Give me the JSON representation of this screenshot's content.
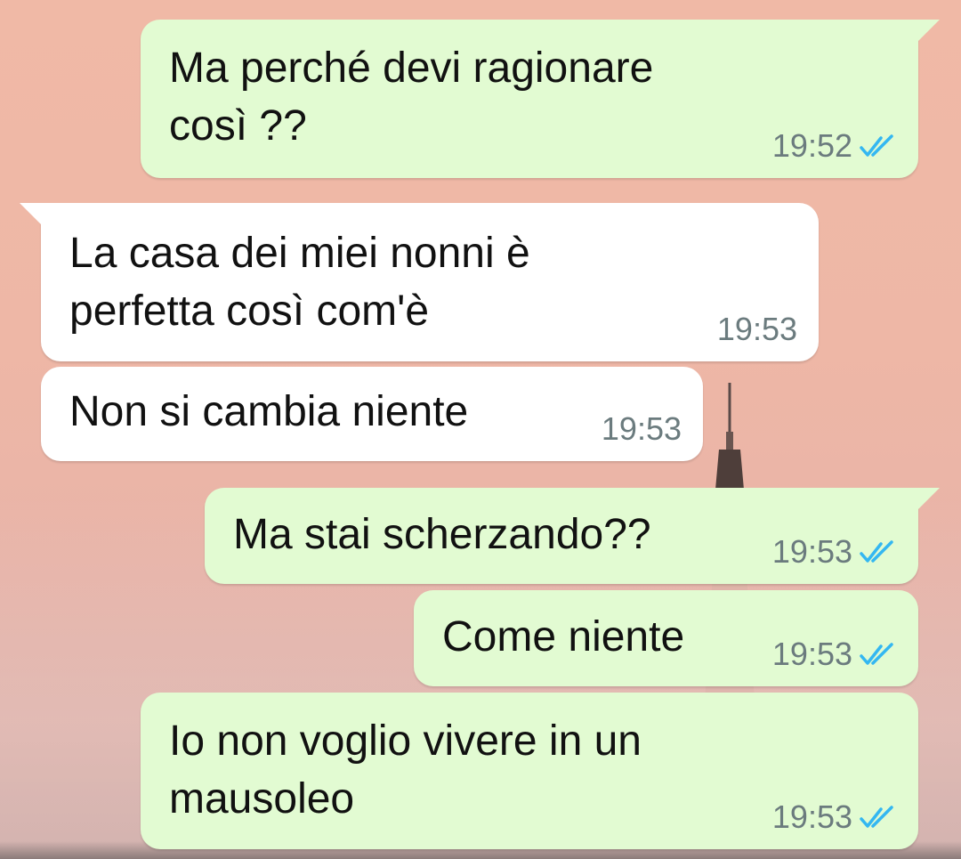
{
  "colors": {
    "outgoing_bubble": "#e2fbd2",
    "incoming_bubble": "#ffffff",
    "timestamp": "#6b7b7e",
    "read_ticks": "#34b7f1"
  },
  "messages": [
    {
      "direction": "outgoing",
      "text": "Ma perché devi ragionare\ncosì ??",
      "time": "19:52",
      "status_icon": "double-check-read-icon"
    },
    {
      "direction": "incoming",
      "text": "La casa dei miei nonni è\nperfetta così com'è",
      "time": "19:53"
    },
    {
      "direction": "incoming",
      "text": "Non si cambia niente",
      "time": "19:53"
    },
    {
      "direction": "outgoing",
      "text": "Ma stai scherzando??",
      "time": "19:53",
      "status_icon": "double-check-read-icon"
    },
    {
      "direction": "outgoing",
      "text": "Come niente",
      "time": "19:53",
      "status_icon": "double-check-read-icon"
    },
    {
      "direction": "outgoing",
      "text": "Io non voglio vivere in un\nmausoleo",
      "time": "19:53",
      "status_icon": "double-check-read-icon"
    }
  ]
}
